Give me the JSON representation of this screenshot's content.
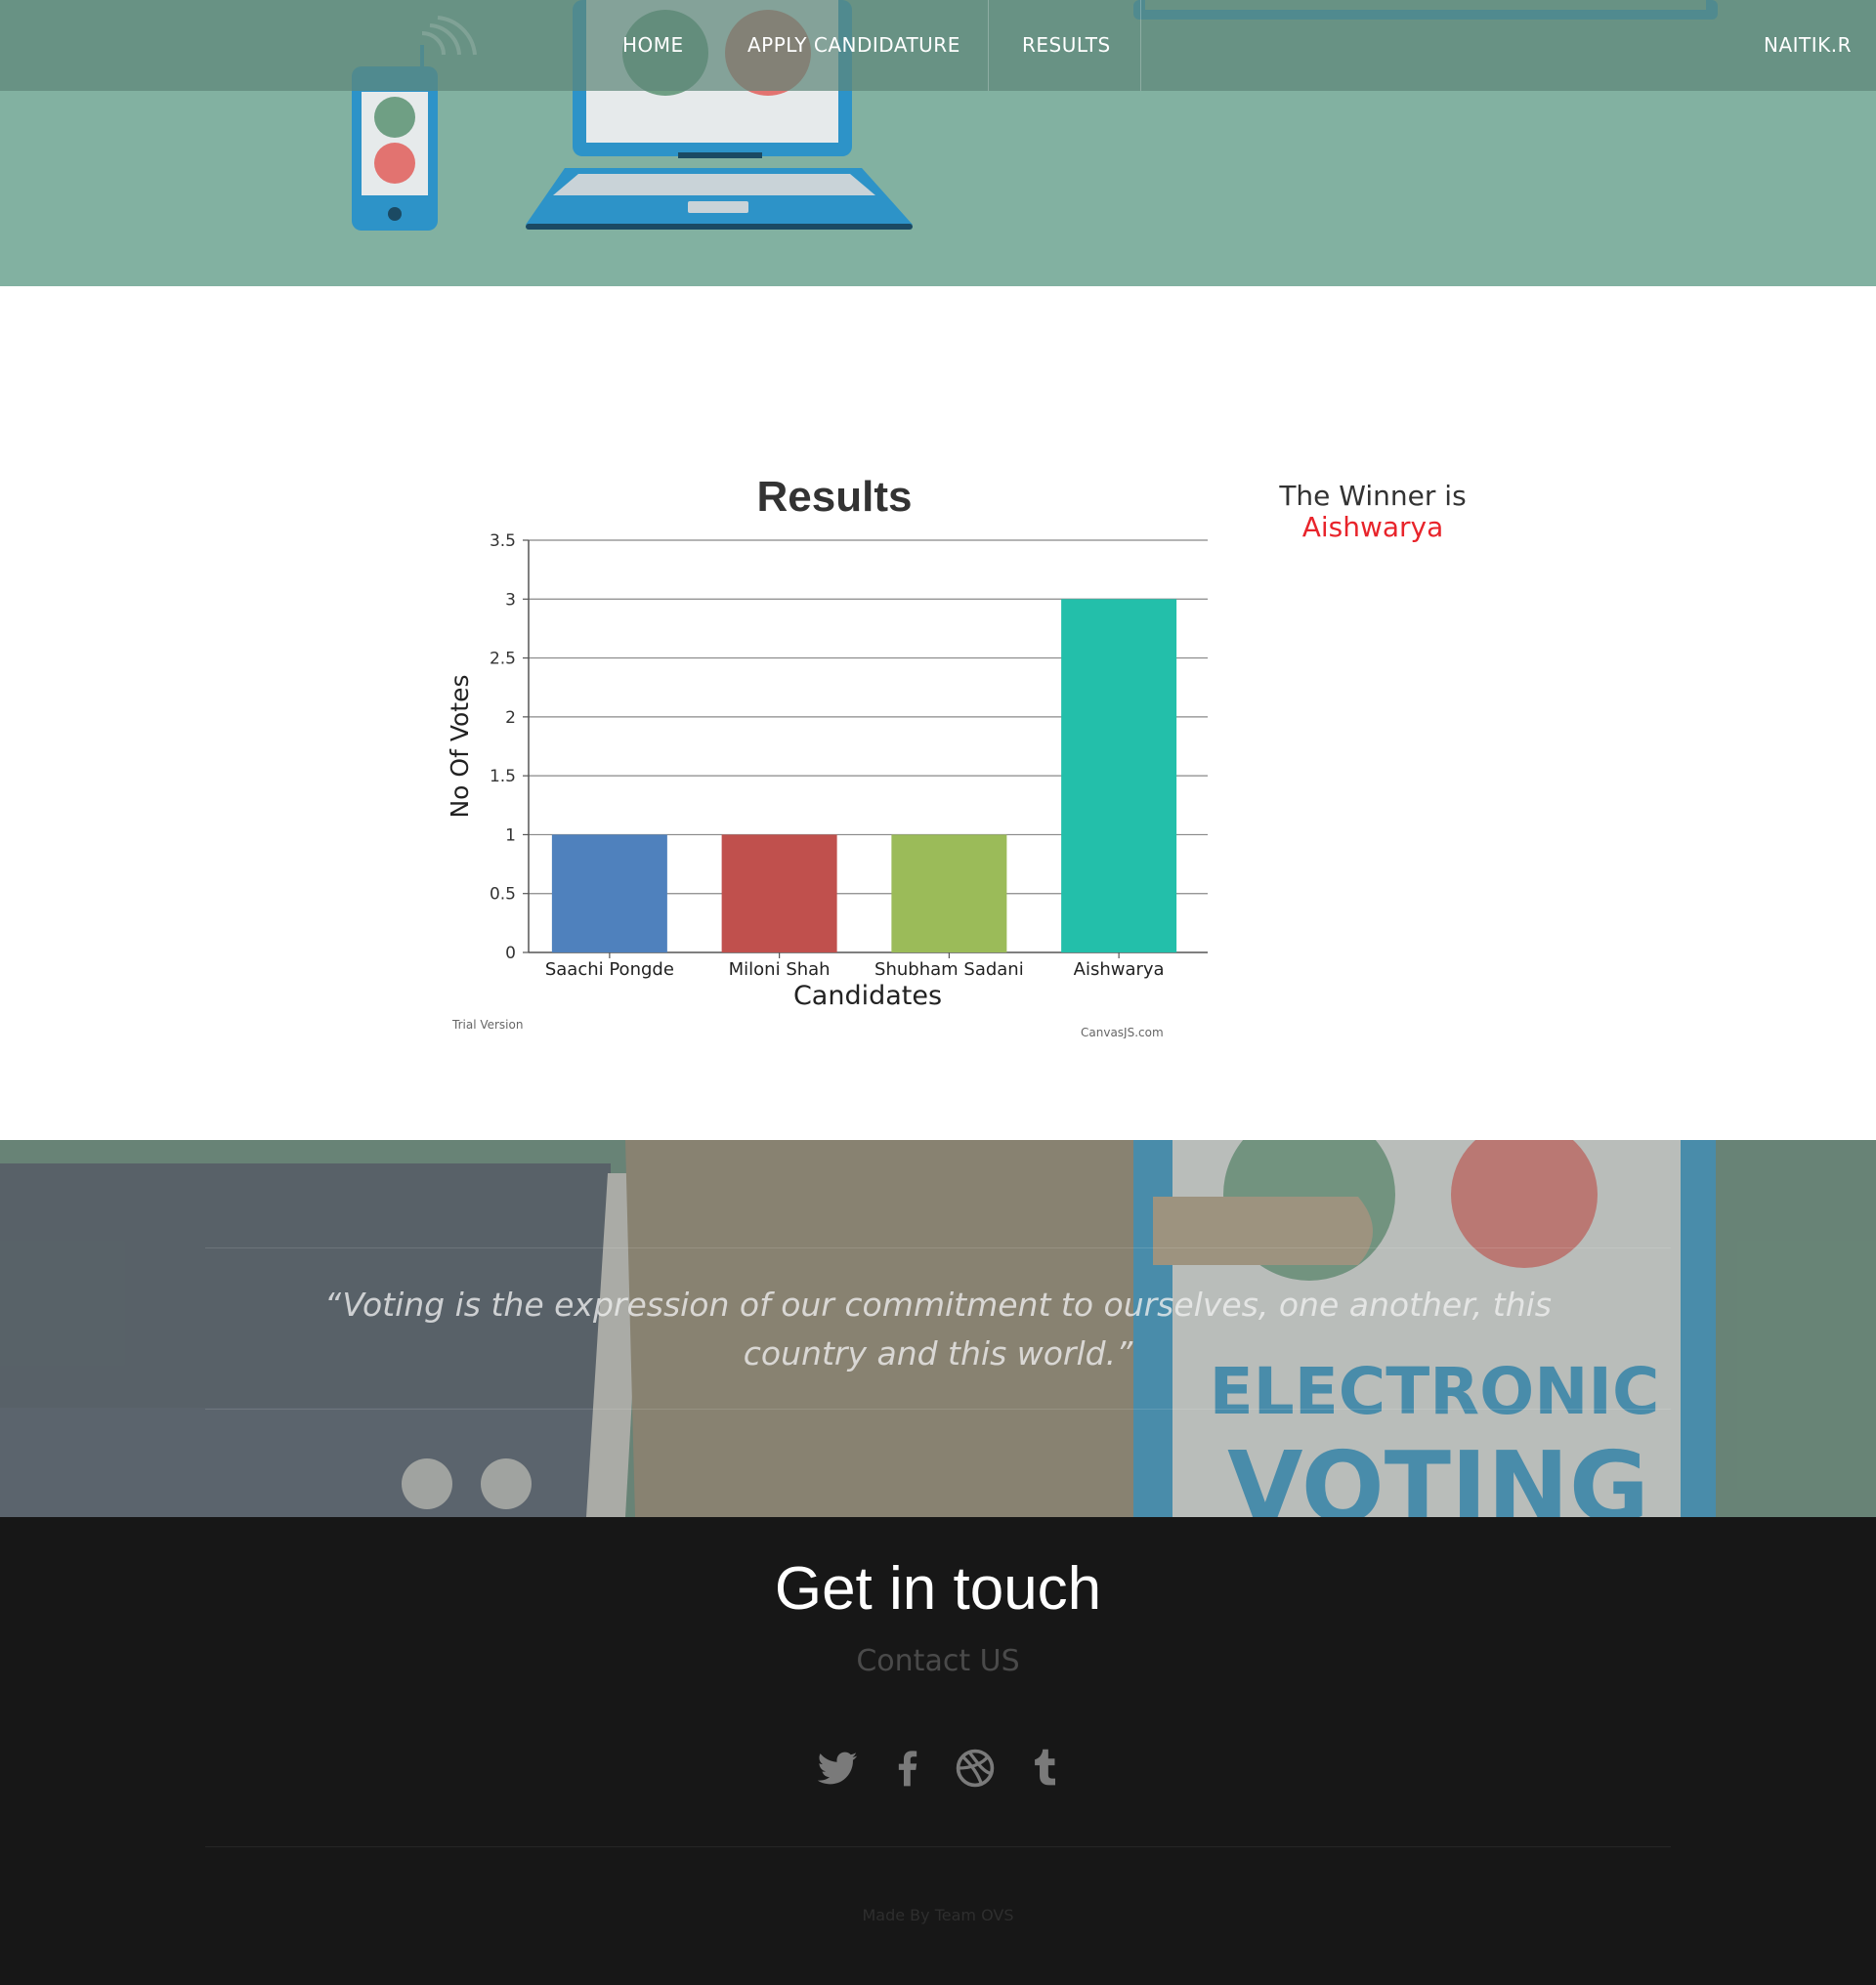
{
  "nav": {
    "items": [
      {
        "label": "HOME"
      },
      {
        "label": "APPLY CANDIDATURE"
      },
      {
        "label": "RESULTS"
      }
    ],
    "user": "NAITIK.R"
  },
  "chart_data": {
    "type": "bar",
    "title": "Results",
    "xlabel": "Candidates",
    "ylabel": "No Of Votes",
    "categories": [
      "Saachi Pongde",
      "Miloni Shah",
      "Shubham Sadani",
      "Aishwarya"
    ],
    "values": [
      1,
      1,
      1,
      3
    ],
    "colors": [
      "#4f81bd",
      "#c0504d",
      "#9bbb59",
      "#23bfaa"
    ],
    "ylim": [
      0,
      3.5
    ],
    "yticks": [
      0,
      0.5,
      1,
      1.5,
      2,
      2.5,
      3,
      3.5
    ],
    "grid": true,
    "watermark_left": "Trial Version",
    "watermark_right": "CanvasJS.com"
  },
  "winner": {
    "label": "The Winner is",
    "name": "Aishwarya"
  },
  "quote": {
    "text": "“Voting is the expression of our commitment to ourselves, one another, this country and this world.”"
  },
  "hero_art": {
    "poster_text_line1": "ELECTRONIC",
    "poster_text_line2": "VOTING"
  },
  "footer": {
    "title": "Get in touch",
    "subtitle": "Contact US",
    "social": [
      {
        "icon": "twitter-icon"
      },
      {
        "icon": "facebook-icon"
      },
      {
        "icon": "dribbble-icon"
      },
      {
        "icon": "tumblr-icon"
      }
    ],
    "credit": "Made By Team OVS"
  },
  "colors": {
    "hero_bg": "#82b1a1",
    "navbar": "#5e8678",
    "winner_name": "#e8242b",
    "footer_bg": "#171717"
  }
}
